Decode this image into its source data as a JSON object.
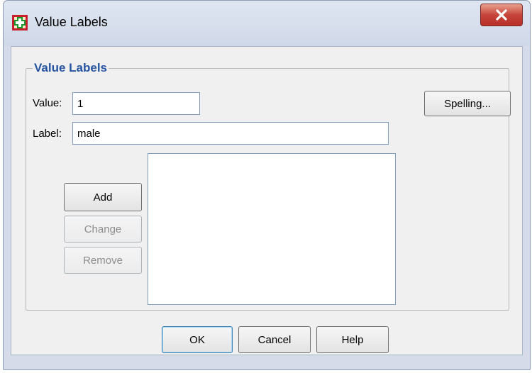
{
  "window": {
    "title": "Value Labels",
    "close_label": "X"
  },
  "group": {
    "title": "Value Labels"
  },
  "form": {
    "value_label": "Value:",
    "value_field": "1",
    "label_label": "Label:",
    "label_field": "male"
  },
  "buttons": {
    "spelling": "Spelling...",
    "add": "Add",
    "change": "Change",
    "remove": "Remove",
    "ok": "OK",
    "cancel": "Cancel",
    "help": "Help"
  },
  "value_labels_list": [],
  "colors": {
    "group_title": "#2554a3",
    "close_button": "#c6453a",
    "app_icon_green": "#1a9a2a",
    "app_icon_red": "#c8202a"
  },
  "icons": {
    "app": "spss-grid-plus-icon",
    "close": "close-icon"
  }
}
